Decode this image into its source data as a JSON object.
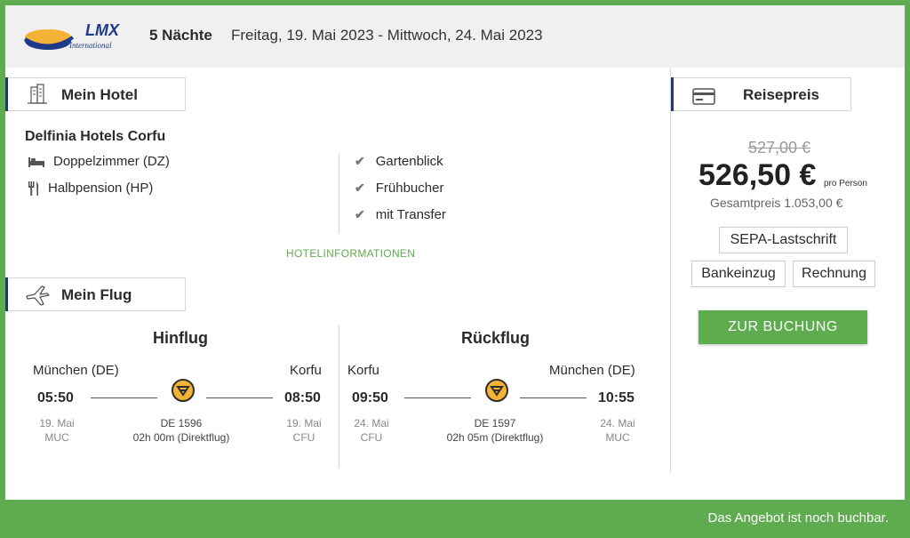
{
  "header": {
    "logo_text": "LMX",
    "logo_subtext": "International",
    "nights": "5 Nächte",
    "dates": "Freitag, 19. Mai 2023 - Mittwoch, 24. Mai 2023"
  },
  "hotel": {
    "section_label": "Mein Hotel",
    "name": "Delfinia Hotels Corfu",
    "room": "Doppelzimmer (DZ)",
    "board": "Halbpension (HP)",
    "features": [
      "Gartenblick",
      "Frühbucher",
      "mit Transfer"
    ],
    "info_link": "HOTELINFORMATIONEN"
  },
  "flight": {
    "section_label": "Mein Flug",
    "outbound": {
      "title": "Hinflug",
      "from_city": "München (DE)",
      "to_city": "Korfu",
      "dep_time": "05:50",
      "arr_time": "08:50",
      "dep_date": "19. Mai",
      "dep_code": "MUC",
      "arr_date": "19. Mai",
      "arr_code": "CFU",
      "flight_no": "DE 1596",
      "duration": "02h 00m (Direktflug)"
    },
    "return": {
      "title": "Rückflug",
      "from_city": "Korfu",
      "to_city": "München (DE)",
      "dep_time": "09:50",
      "arr_time": "10:55",
      "dep_date": "24. Mai",
      "dep_code": "CFU",
      "arr_date": "24. Mai",
      "arr_code": "MUC",
      "flight_no": "DE 1597",
      "duration": "02h 05m (Direktflug)"
    }
  },
  "price": {
    "section_label": "Reisepreis",
    "old_price": "527,00 €",
    "price": "526,50 €",
    "per_person": "pro Person",
    "total": "Gesamtpreis 1.053,00 €",
    "payment_methods": [
      "SEPA-Lastschrift",
      "Bankeinzug",
      "Rechnung"
    ],
    "book_button": "ZUR BUCHUNG"
  },
  "footer": {
    "status": "Das Angebot ist noch buchbar."
  },
  "colors": {
    "accent_green": "#5fab4f",
    "navy": "#1f3a6b",
    "airline_yellow": "#f5b335",
    "logo_blue": "#1f3a8a"
  },
  "icons": {
    "hotel": "hotel-building-icon",
    "flight": "airplane-icon",
    "price": "credit-card-icon",
    "room": "bed-icon",
    "board": "cutlery-icon",
    "feature": "checkmark-icon",
    "airline": "airline-logo-icon"
  }
}
